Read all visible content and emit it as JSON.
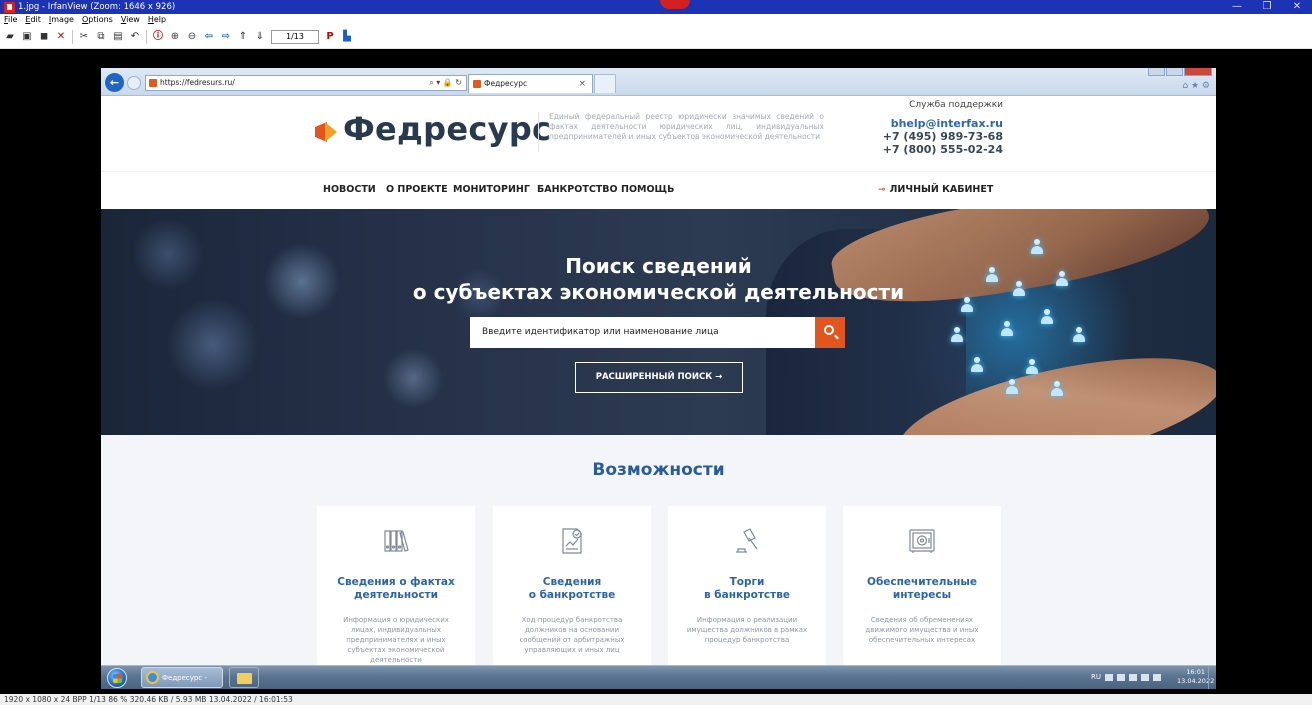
{
  "viewer": {
    "title": "1.jpg - IrfanView (Zoom: 1646 x 926)",
    "menu": [
      "File",
      "Edit",
      "Image",
      "Options",
      "View",
      "Help"
    ],
    "page_indicator": "1/13",
    "status": "1920 x 1080 x 24 BPP   1/13   86 %   320.46 KB / 5.93 MB   13.04.2022 / 16:01:53",
    "window_controls": {
      "minimize": "—",
      "restore": "❐",
      "close": "✕"
    }
  },
  "browser": {
    "url": "https://fedresurs.ru/",
    "address_controls": "⌕ ▾ 🔒 ↻",
    "tab_title": "Федресурс",
    "tab_close": "×",
    "toolbar_icons": "⌂ ★ ⚙"
  },
  "site": {
    "logo": "Федресурс",
    "description": "Единый федеральный реестр юридически значимых сведений о фактах деятельности юридических лиц, индивидуальных предпринимателей и иных субъектов экономической деятельности",
    "support_label": "Служба поддержки",
    "support_email": "bhelp@interfax.ru",
    "phone_1": "+7 (495) 989-73-68",
    "phone_2": "+7 (800) 555-02-24",
    "nav": [
      "НОВОСТИ",
      "О ПРОЕКТЕ",
      "МОНИТОРИНГ",
      "БАНКРОТСТВО",
      "ПОМОЩЬ"
    ],
    "cabinet": "ЛИЧНЫЙ КАБИНЕТ",
    "hero_title_1": "Поиск сведений",
    "hero_title_2": "о субъектах экономической деятельности",
    "search_placeholder": "Введите идентификатор или наименование лица",
    "advanced_search": "РАСШИРЕННЫЙ ПОИСК →",
    "opportunities_title": "Возможности",
    "cards": [
      {
        "title_1": "Сведения о фактах",
        "title_2": "деятельности",
        "desc": "Информация о юридических лицах, индивидуальных предпринимателях и иных субъектах экономической деятельности",
        "icon": "binders-icon"
      },
      {
        "title_1": "Сведения",
        "title_2": "о банкротстве",
        "desc": "Ход процедур банкротства должников на основании сообщений от арбитражных управляющих и иных лиц",
        "icon": "document-chart-icon"
      },
      {
        "title_1": "Торги",
        "title_2": "в банкротстве",
        "desc": "Информация о реализации имущества должников в рамках процедур банкротства",
        "icon": "gavel-icon"
      },
      {
        "title_1": "Обеспечительные",
        "title_2": "интересы",
        "desc": "Сведения об обременениях движимого имущества и иных обеспечительных интересах",
        "icon": "safe-icon"
      }
    ]
  },
  "taskbar": {
    "ie_task": "Федресурс - Inter...",
    "lang": "RU",
    "time": "16:01",
    "date": "13.04.2022"
  }
}
